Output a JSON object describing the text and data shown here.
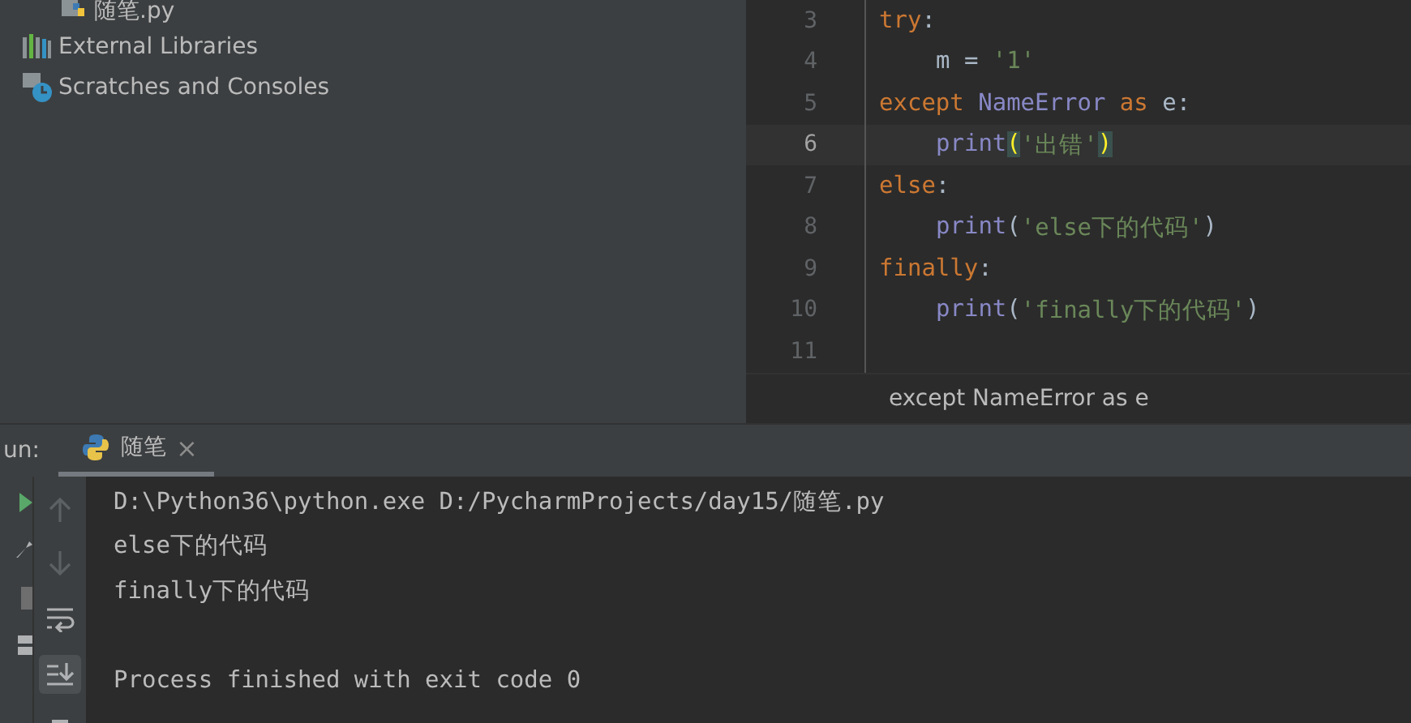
{
  "project_tree": {
    "items": [
      {
        "label": "随笔.py",
        "kind": "python-file"
      },
      {
        "label": "External Libraries",
        "kind": "libraries"
      },
      {
        "label": "Scratches and Consoles",
        "kind": "scratches"
      }
    ]
  },
  "editor": {
    "lines": [
      {
        "number": "3",
        "current": false,
        "indent": false,
        "tokens": [
          {
            "text": "try",
            "kind": "keyword"
          },
          {
            "text": ":",
            "kind": "plain"
          }
        ]
      },
      {
        "number": "4",
        "current": false,
        "indent": true,
        "tokens": [
          {
            "text": "m = ",
            "kind": "plain"
          },
          {
            "text": "'1'",
            "kind": "string"
          }
        ]
      },
      {
        "number": "5",
        "current": false,
        "indent": false,
        "tokens": [
          {
            "text": "except ",
            "kind": "keyword"
          },
          {
            "text": "NameError ",
            "kind": "builtin"
          },
          {
            "text": "as ",
            "kind": "keyword"
          },
          {
            "text": "e:",
            "kind": "plain"
          }
        ]
      },
      {
        "number": "6",
        "current": true,
        "indent": true,
        "tokens": [
          {
            "text": "print",
            "kind": "builtin"
          },
          {
            "text": "(",
            "kind": "brace"
          },
          {
            "text": "'出错'",
            "kind": "string"
          },
          {
            "text": ")",
            "kind": "brace"
          }
        ]
      },
      {
        "number": "7",
        "current": false,
        "indent": false,
        "tokens": [
          {
            "text": "else",
            "kind": "keyword"
          },
          {
            "text": ":",
            "kind": "plain"
          }
        ]
      },
      {
        "number": "8",
        "current": false,
        "indent": true,
        "tokens": [
          {
            "text": "print",
            "kind": "builtin"
          },
          {
            "text": "(",
            "kind": "plain"
          },
          {
            "text": "'else下的代码'",
            "kind": "string"
          },
          {
            "text": ")",
            "kind": "plain"
          }
        ]
      },
      {
        "number": "9",
        "current": false,
        "indent": false,
        "tokens": [
          {
            "text": "finally",
            "kind": "keyword"
          },
          {
            "text": ":",
            "kind": "plain"
          }
        ]
      },
      {
        "number": "10",
        "current": false,
        "indent": true,
        "tokens": [
          {
            "text": "print",
            "kind": "builtin"
          },
          {
            "text": "(",
            "kind": "plain"
          },
          {
            "text": "'finally下的代码'",
            "kind": "string"
          },
          {
            "text": ")",
            "kind": "plain"
          }
        ]
      },
      {
        "number": "11",
        "current": false
      }
    ],
    "breadcrumb": "except NameError as e"
  },
  "run_panel": {
    "label": "un:",
    "tabs": [
      {
        "label": "随笔",
        "selected": true,
        "close": "×"
      }
    ],
    "output_blocks": [
      [
        "D:\\Python36\\python.exe D:/PycharmProjects/day15/随笔.py",
        "else下的代码",
        "finally下的代码"
      ],
      [
        "Process finished with exit code 0"
      ]
    ]
  }
}
